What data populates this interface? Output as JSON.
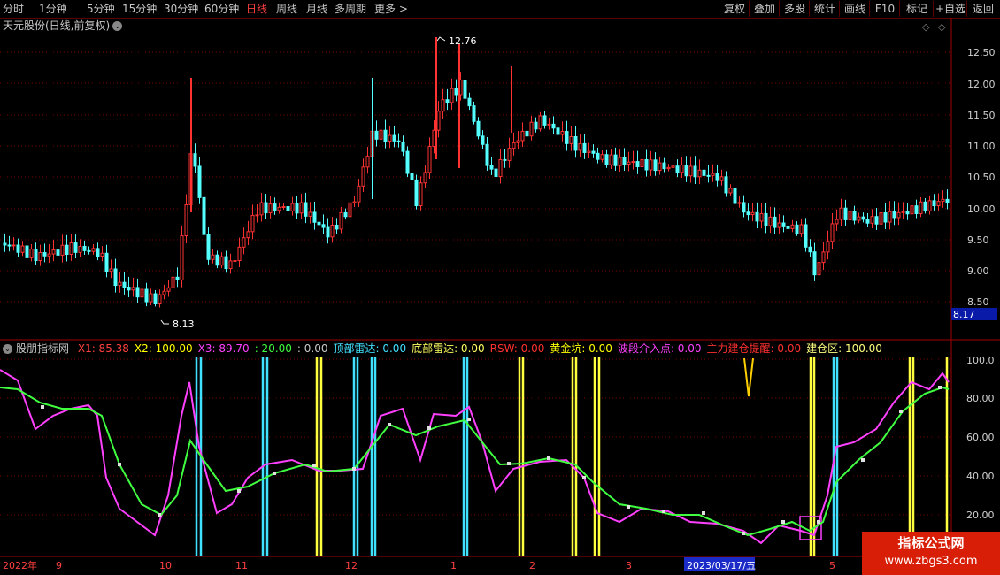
{
  "periods": [
    "分时",
    "1分钟",
    "5分钟",
    "15分钟",
    "30分钟",
    "60分钟",
    "日线",
    "周线",
    "月线",
    "多周期",
    "更多 >"
  ],
  "active_period": "日线",
  "tools": [
    "复权",
    "叠加",
    "多股",
    "统计",
    "画线",
    "F10",
    "标记",
    "+自选",
    "返回"
  ],
  "stock_title": "天元股份(日线,前复权)",
  "price_axis": [
    "12.50",
    "12.00",
    "11.50",
    "11.00",
    "10.50",
    "10.00",
    "9.50",
    "9.00",
    "8.50"
  ],
  "current_price_tag": "8.17",
  "high_marker": "12.76",
  "low_marker": "8.13",
  "indicator": {
    "name": "股朋指标网",
    "items": [
      {
        "label": "X1:",
        "value": "85.38",
        "color": "#ff4040"
      },
      {
        "label": "X2:",
        "value": "100.00",
        "color": "#ffff00"
      },
      {
        "label": "X3:",
        "value": "89.70",
        "color": "#ff40ff"
      },
      {
        "label": ":",
        "value": "20.00",
        "color": "#40ff40"
      },
      {
        "label": ":",
        "value": "0.00",
        "color": "#c8c8c8"
      },
      {
        "label": "顶部雷达:",
        "value": "0.00",
        "color": "#40e0ff"
      },
      {
        "label": "底部雷达:",
        "value": "0.00",
        "color": "#ffff60"
      },
      {
        "label": "RSW:",
        "value": "0.00",
        "color": "#ff3030"
      },
      {
        "label": "黄金坑:",
        "value": "0.00",
        "color": "#ffff00"
      },
      {
        "label": "波段介入点:",
        "value": "0.00",
        "color": "#ff40ff"
      },
      {
        "label": "主力建仓提醒:",
        "value": "0.00",
        "color": "#ff3030"
      },
      {
        "label": "建仓区:",
        "value": "100.00",
        "color": "#ffff80"
      }
    ]
  },
  "indicator_axis": [
    "100.0",
    "80.00",
    "60.00",
    "40.00",
    "20.00"
  ],
  "date_labels": [
    "2022年",
    "9",
    "10",
    "11",
    "12",
    "1",
    "2",
    "3",
    "2023/03/17/五",
    "5"
  ],
  "watermark_title": "指标公式网",
  "watermark_url": "www.zbgs3.com",
  "colors": {
    "up": "#ff3232",
    "down": "#54ffff",
    "grid": "#8a0000",
    "cyan_bar": "#40e0ff",
    "yellow_bar": "#ffff40",
    "magenta": "#ff40ff",
    "green": "#40ff40"
  }
}
